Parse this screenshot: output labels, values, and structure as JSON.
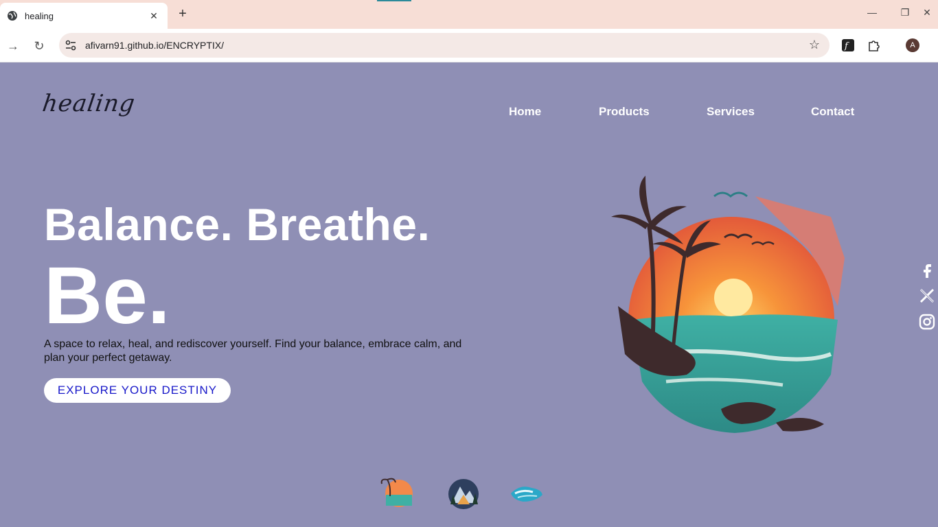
{
  "browser": {
    "tab_title": "healing",
    "url": "afivarn91.github.io/ENCRYPTIX/",
    "avatar_letter": "A"
  },
  "site": {
    "logo": "healing",
    "nav": [
      "Home",
      "Products",
      "Services",
      "Contact"
    ],
    "headline_1": "Balance. Breathe.",
    "headline_2": "Be.",
    "description": "A space to relax, heal, and rediscover yourself. Find your balance, embrace calm, and plan your perfect getaway.",
    "cta": "EXPLORE YOUR DESTINY",
    "social": [
      "facebook-icon",
      "x-icon",
      "instagram-icon"
    ]
  },
  "colors": {
    "page_bg": "#8f8fb5",
    "tabbar_bg": "#f7ded6",
    "cta_text": "#1717c9"
  }
}
